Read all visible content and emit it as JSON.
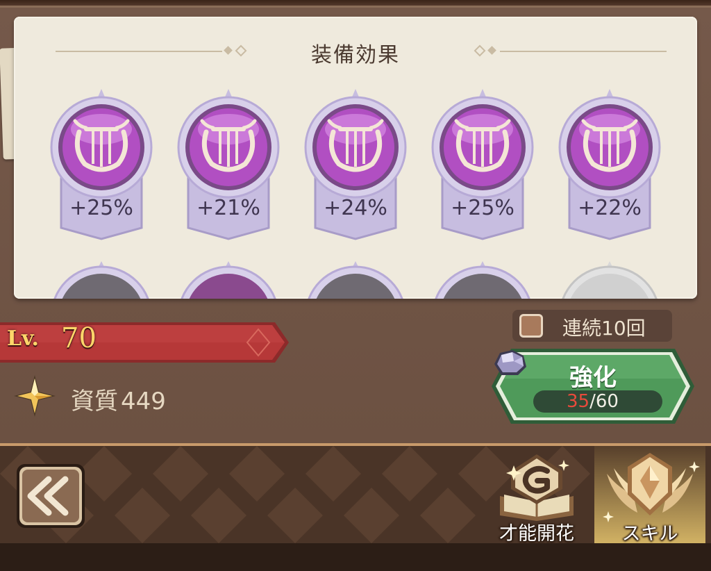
{
  "effects_panel": {
    "title": "装備効果",
    "items": [
      {
        "icon": "lyre-icon",
        "value": "+25%"
      },
      {
        "icon": "lyre-icon",
        "value": "+21%"
      },
      {
        "icon": "lyre-icon",
        "value": "+24%"
      },
      {
        "icon": "lyre-icon",
        "value": "+25%"
      },
      {
        "icon": "lyre-icon",
        "value": "+22%"
      }
    ]
  },
  "level": {
    "prefix": "Lv.",
    "value": "70"
  },
  "quality": {
    "label": "資質",
    "value": "449",
    "icon": "star-icon"
  },
  "repeat_toggle": {
    "label": "連続10回",
    "checked": false
  },
  "enhance_button": {
    "label": "強化",
    "cost_current": "35",
    "cost_max": "/60",
    "cost_icon": "ore-icon"
  },
  "bottom_nav": {
    "back_icon": "double-chevron-left-icon",
    "items": [
      {
        "label": "才能開花",
        "icon": "talent-book-icon",
        "active": false
      },
      {
        "label": "スキル",
        "icon": "skill-emblem-icon",
        "active": true
      }
    ]
  },
  "colors": {
    "badge_purple": "#b14fc2",
    "level_banner_red": "#b63838",
    "enhance_green": "#4f9a5a",
    "cost_current_red": "#e84a3c"
  }
}
